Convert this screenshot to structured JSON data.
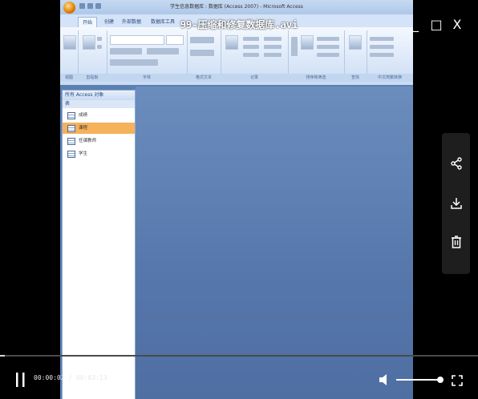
{
  "player": {
    "file_title": "99-压缩和修复数据库.avi",
    "time_current": "00:00:02",
    "time_total": "00:03:13",
    "time_separator": " / ",
    "progress_fraction": 0.01,
    "volume_fraction": 1.0,
    "window_controls": {
      "minimize": "_",
      "maximize": "□",
      "close": "X"
    },
    "side_actions": [
      "share-icon",
      "download-icon",
      "delete-icon"
    ]
  },
  "access": {
    "title": "学生信息数据库 : 数据库 (Access 2007) - Microsoft Access",
    "tabs": [
      "开始",
      "创建",
      "外部数据",
      "数据库工具"
    ],
    "ribbon_groups": [
      "视图",
      "剪贴板",
      "字体",
      "格式文本",
      "记录",
      "排序和筛选",
      "查找",
      "中文简繁转换"
    ],
    "nav": {
      "header": "所有 Access 对象",
      "section": "表",
      "items": [
        "成绩",
        "课程",
        "任课教师",
        "学生"
      ],
      "selected_index": 1
    }
  }
}
